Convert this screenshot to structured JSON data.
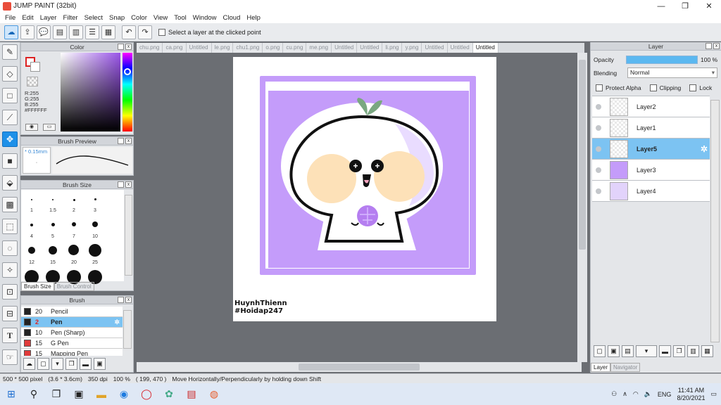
{
  "window": {
    "title": "JUMP PAINT (32bit)",
    "minimize": "—",
    "maximize": "❐",
    "close": "✕"
  },
  "menu": [
    "File",
    "Edit",
    "Layer",
    "Filter",
    "Select",
    "Snap",
    "Color",
    "View",
    "Tool",
    "Window",
    "Cloud",
    "Help"
  ],
  "toolbar": {
    "select_layer_label": "Select a layer at the clicked point"
  },
  "color_panel": {
    "title": "Color",
    "r": "R:255",
    "g": "G:255",
    "b": "B:255",
    "hex": "#FFFFFF"
  },
  "brush_preview": {
    "title": "Brush Preview",
    "size": "0.15mm"
  },
  "brush_size": {
    "title": "Brush Size",
    "labels": [
      "1",
      "1.5",
      "2",
      "3",
      "4",
      "5",
      "7",
      "10",
      "12",
      "15",
      "20",
      "25"
    ],
    "tab_active": "Brush Size",
    "tab_inactive": "Brush Control"
  },
  "brush_panel": {
    "title": "Brush",
    "items": [
      {
        "num": "20",
        "name": "Pencil",
        "color": "#222222"
      },
      {
        "num": "2",
        "name": "Pen",
        "color": "#222222"
      },
      {
        "num": "10",
        "name": "Pen (Sharp)",
        "color": "#222222"
      },
      {
        "num": "15",
        "name": "G Pen",
        "color": "#e03b3b"
      },
      {
        "num": "15",
        "name": "Mapping Pen",
        "color": "#e03b3b"
      }
    ]
  },
  "tabs": [
    "chu.png",
    "ca.png",
    "Untitled",
    "le.png",
    "chu1.png",
    "o.png",
    "cu.png",
    "me.png",
    "Untitled",
    "Untitled",
    "li.png",
    "y.png",
    "Untitled",
    "Untitled",
    "Untitled"
  ],
  "canvas": {
    "sign_line1": "HuynhThienn",
    "sign_line2": "#Hoidap247",
    "face_left": "+",
    "face_right": "+"
  },
  "layer_panel": {
    "title": "Layer",
    "opacity_label": "Opacity",
    "opacity_value": "100 %",
    "opacity": 1.0,
    "blending_label": "Blending",
    "blending_value": "Normal",
    "protect_alpha": "Protect Alpha",
    "clipping": "Clipping",
    "lock": "Lock",
    "layers": [
      "Layer2",
      "Layer1",
      "Layer5",
      "Layer3",
      "Layer4"
    ],
    "tab_active": "Layer",
    "tab_inactive": "Navigator"
  },
  "status": {
    "size": "500 * 500 pixel",
    "cm": "(3.6 * 3.6cm)",
    "dpi": "350 dpi",
    "zoom": "100 %",
    "coords": "( 199, 470 )",
    "hint": "Move Horizontally/Perpendicularly by holding down Shift"
  },
  "taskbar": {
    "time": "11:41 AM",
    "date": "8/20/2021",
    "lang": "ENG"
  },
  "colors": {
    "accent": "#1e90e8",
    "purple": "#c49cfa",
    "peach": "#fde1b8"
  }
}
